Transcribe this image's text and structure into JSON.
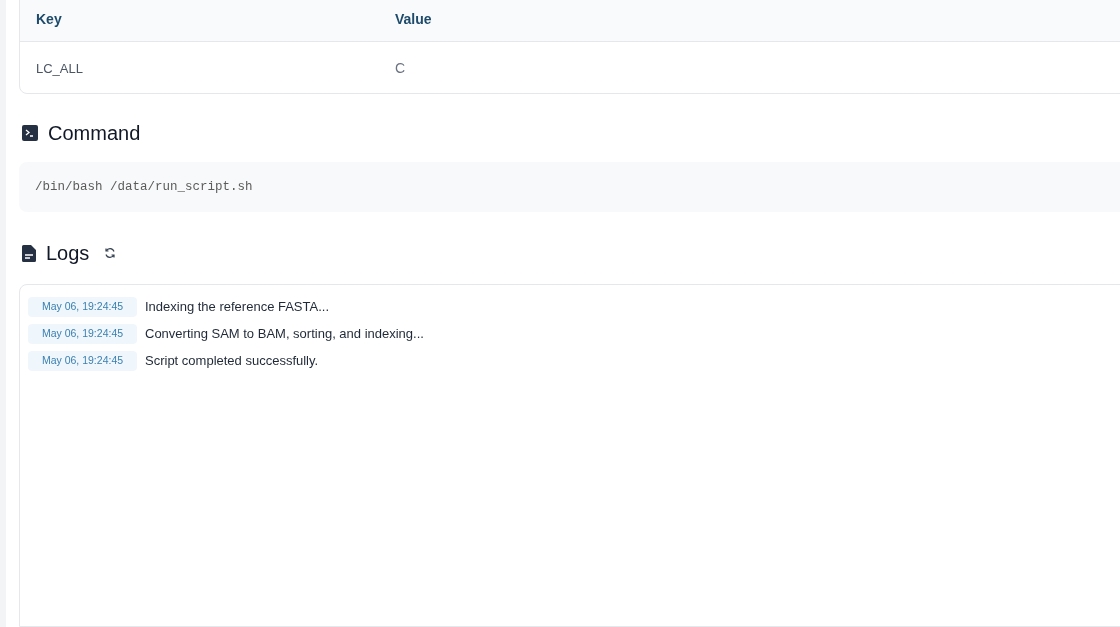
{
  "env_table": {
    "columns": [
      "Key",
      "Value"
    ],
    "rows": [
      {
        "key": "LC_ALL",
        "value": "C"
      }
    ]
  },
  "command": {
    "title": "Command",
    "text": "/bin/bash /data/run_script.sh"
  },
  "logs": {
    "title": "Logs",
    "entries": [
      {
        "time": "May 06, 19:24:45",
        "message": "Indexing the reference FASTA..."
      },
      {
        "time": "May 06, 19:24:45",
        "message": "Converting SAM to BAM, sorting, and indexing..."
      },
      {
        "time": "May 06, 19:24:45",
        "message": "Script completed successfully."
      }
    ]
  }
}
